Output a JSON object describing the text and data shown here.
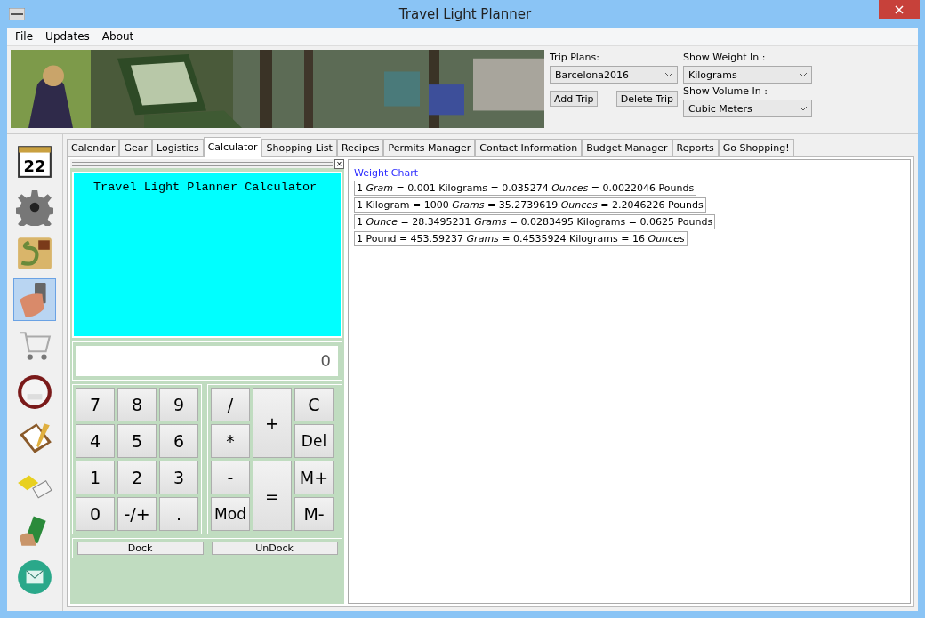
{
  "window": {
    "title": "Travel Light Planner"
  },
  "menu": [
    "File",
    "Updates",
    "About"
  ],
  "header": {
    "banner": {
      "kind": "picture"
    },
    "trip_plans": {
      "label": "Trip Plans:",
      "value": "Barcelona2016"
    },
    "buttons": [
      "Add Trip",
      "Delete Trip"
    ],
    "weight": {
      "label": "Show Weight In :",
      "value": "Kilograms"
    },
    "volume": {
      "label": "Show Volume In :",
      "value": "Cubic Meters"
    }
  },
  "sidebar": {
    "items": [
      {
        "kind": "calendar",
        "text": "22",
        "selected": false
      },
      {
        "kind": "gear",
        "selected": false
      },
      {
        "kind": "map",
        "selected": false
      },
      {
        "kind": "calculator",
        "selected": true
      },
      {
        "kind": "cart",
        "selected": false
      },
      {
        "kind": "chef",
        "selected": false
      },
      {
        "kind": "clipboard",
        "selected": false
      },
      {
        "kind": "phone",
        "selected": false
      },
      {
        "kind": "money",
        "selected": false
      },
      {
        "kind": "mail",
        "selected": false
      }
    ]
  },
  "tabs": [
    {
      "label": "Calendar",
      "selected": false
    },
    {
      "label": "Gear",
      "selected": false
    },
    {
      "label": "Logistics",
      "selected": false
    },
    {
      "label": "Calculator",
      "selected": true
    },
    {
      "label": "Shopping List",
      "selected": false
    },
    {
      "label": "Recipes",
      "selected": false
    },
    {
      "label": "Permits Manager",
      "selected": false
    },
    {
      "label": "Contact Information",
      "selected": false
    },
    {
      "label": "Budget Manager",
      "selected": false
    },
    {
      "label": "Reports",
      "selected": false
    },
    {
      "label": "Go Shopping!",
      "selected": false
    }
  ],
  "calculator": {
    "close": "×",
    "tape_title": "Travel Light Planner Calculator",
    "display": "0",
    "digits": [
      "7",
      "8",
      "9",
      "4",
      "5",
      "6",
      "1",
      "2",
      "3",
      "0",
      "-/+",
      "."
    ],
    "ops": [
      {
        "label": "/",
        "kind": "single"
      },
      {
        "label": "+",
        "kind": "tall"
      },
      {
        "label": "C",
        "kind": "single"
      },
      {
        "label": "*",
        "kind": "single"
      },
      {
        "label": "Del",
        "kind": "single"
      },
      {
        "label": "-",
        "kind": "single"
      },
      {
        "label": "=",
        "kind": "tall"
      },
      {
        "label": "M+",
        "kind": "single"
      },
      {
        "label": "Mod",
        "kind": "single"
      },
      {
        "label": "M-",
        "kind": "single"
      }
    ],
    "dock_buttons": [
      "Dock",
      "UnDock"
    ]
  },
  "weight_chart": {
    "title": "Weight Chart",
    "rows": [
      "1 *Gram* = 0.001 Kilograms =  0.035274 *Ounces* = 0.0022046 Pounds",
      "1 Kilogram =  1000 *Grams* = 35.2739619 *Ounces* = 2.2046226 Pounds",
      "1 *Ounce* = 28.3495231 *Grams* = 0.0283495 Kilograms = 0.0625 Pounds",
      "1 Pound = 453.59237 *Grams* = 0.4535924 Kilograms = 16 *Ounces*"
    ]
  }
}
